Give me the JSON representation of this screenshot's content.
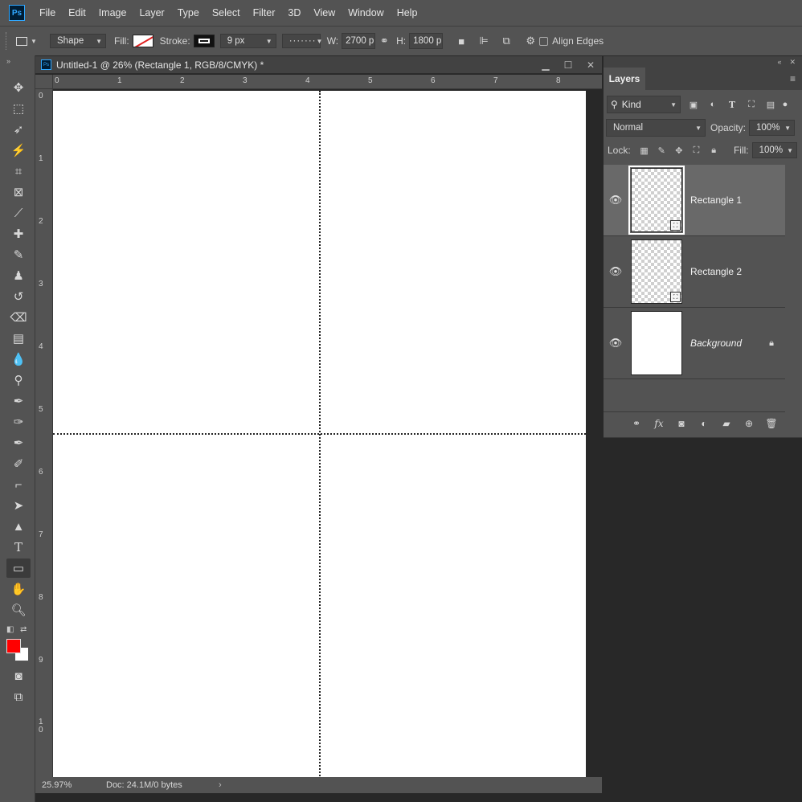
{
  "menubar": {
    "logo": "Ps",
    "items": [
      "File",
      "Edit",
      "Image",
      "Layer",
      "Type",
      "Select",
      "Filter",
      "3D",
      "View",
      "Window",
      "Help"
    ]
  },
  "options": {
    "mode": "Shape",
    "fill_label": "Fill:",
    "stroke_label": "Stroke:",
    "stroke_width": "9 px",
    "w_label": "W:",
    "w_value": "2700 p",
    "h_label": "H:",
    "h_value": "1800 p",
    "align_edges": "Align Edges"
  },
  "document": {
    "title": "Untitled-1 @ 26% (Rectangle 1, RGB/8/CMYK) *",
    "icon": "Ps",
    "zoom": "25.97%",
    "doc_info": "Doc: 24.1M/0 bytes",
    "ruler_h": [
      "0",
      "1",
      "2",
      "3",
      "4",
      "5",
      "6",
      "7",
      "8"
    ],
    "ruler_v": [
      "0",
      "1",
      "2",
      "3",
      "4",
      "5",
      "6",
      "7",
      "8",
      "9",
      "1\n0"
    ]
  },
  "colors": {
    "foreground": "#ff0000",
    "background": "#ffffff",
    "accent": "#31a8ff"
  },
  "layers_panel": {
    "tab": "Layers",
    "filter_kind": "Kind",
    "blend_mode": "Normal",
    "opacity_label": "Opacity:",
    "opacity": "100%",
    "lock_label": "Lock:",
    "fill_label": "Fill:",
    "fill": "100%",
    "layers": [
      {
        "name": "Rectangle 1",
        "selected": true
      },
      {
        "name": "Rectangle 2",
        "selected": false
      },
      {
        "name": "Background",
        "selected": false
      }
    ]
  }
}
